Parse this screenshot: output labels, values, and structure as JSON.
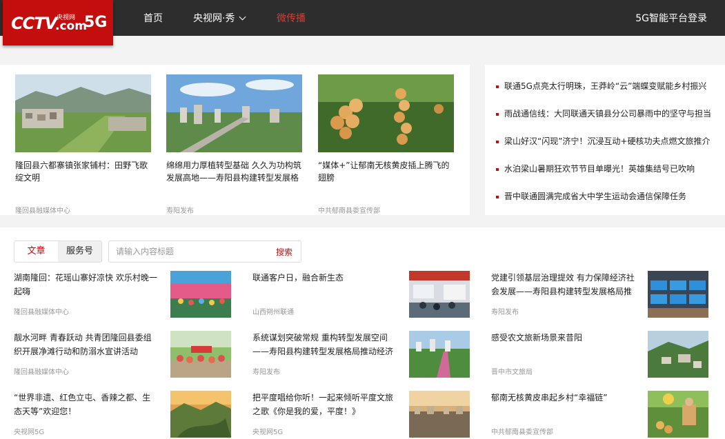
{
  "header": {
    "logo": {
      "cctv": "CCTV",
      "small": "央视网",
      "com": ".com",
      "g5": "5G"
    },
    "nav": [
      {
        "label": "首页"
      },
      {
        "label": "央视网·秀"
      },
      {
        "label": "微传播"
      }
    ],
    "login": "5G智能平台登录"
  },
  "featured": [
    {
      "title": "隆回县六都寨镇张家铺村：田野飞歌绽文明",
      "source": "隆回县融媒体中心"
    },
    {
      "title": "绵绵用力厚植转型基础 久久为功构筑发展高地——寿阳县构建转型发展格局推动经济高质量发展",
      "source": "寿阳发布"
    },
    {
      "title": "“媒体+”让郁南无核黄皮插上腾飞的翅膀",
      "source": "中共郁南县委宣传部"
    }
  ],
  "headlines": [
    "联通5G点亮太行明珠，王莽岭“云”端蝶变赋能乡村振兴",
    "雨战通信线：大同联通天镇县分公司暴雨中的坚守与担当",
    "梁山好汉“闪现”济宁！沉浸互动+硬核功夫点燃文旅推介",
    "水泊梁山暑期狂欢节节目单曝光！英雄集结号已吹响",
    "晋中联通圆满完成省大中学生运动会通信保障任务"
  ],
  "tabs": [
    "文章",
    "服务号"
  ],
  "search": {
    "placeholder": "请输入内容标题",
    "button": "搜索"
  },
  "articles": [
    {
      "title": "湖南隆回：花瑶山寨好凉快 欢乐村晚一起嗨",
      "source": "隆回县融媒体中心"
    },
    {
      "title": "联通客户日，融合新生态",
      "source": "山西朔州联通"
    },
    {
      "title": "党建引领基层治理提效 有力保障经济社会发展——寿阳县构建转型发展格局推动经济高质量发展",
      "source": "寿阳发布"
    },
    {
      "title": "靓水河畔 青春跃动 共青团隆回县委组织开展净滩行动和防溺水宣讲活动",
      "source": "隆回县融媒体中心"
    },
    {
      "title": "系统谋划突破常规 重构转型发展空间——寿阳县构建转型发展格局推动经济高质量发展",
      "source": "寿阳发布"
    },
    {
      "title": "感受农文旅新场景来昔阳",
      "source": "晋中市文旅局"
    },
    {
      "title": "“世界非遗、红色立屯、香辣之都、生态天等”欢迎您！",
      "source": "央视网5G"
    },
    {
      "title": "把平度唱给你听！一起来倾听平度文旅之歌《你是我的爱，平度！》",
      "source": "央视网5G"
    },
    {
      "title": "郁南无核黄皮串起乡村“幸福链”",
      "source": "中共郁南县委宣传部"
    }
  ],
  "colors": {
    "header_bg": "#2d2d2d",
    "brand_red": "#c40d0d",
    "active_nav": "#e03a2e",
    "page_bg": "#f3f3f3"
  }
}
